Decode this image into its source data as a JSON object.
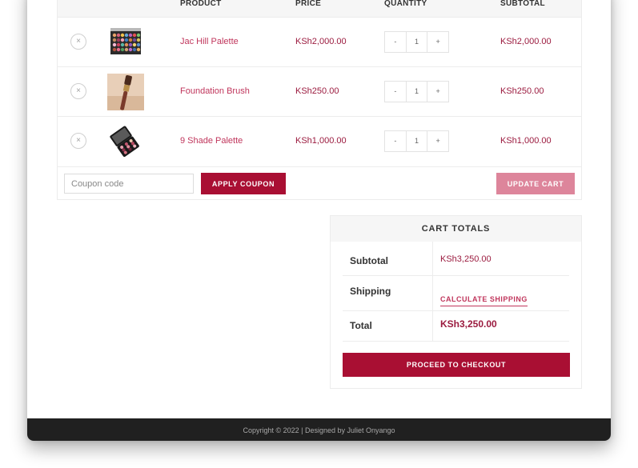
{
  "table": {
    "headers": {
      "product": "PRODUCT",
      "price": "PRICE",
      "quantity": "QUANTITY",
      "subtotal": "SUBTOTAL"
    },
    "rows": [
      {
        "remove": "×",
        "name": "Jac Hill Palette",
        "price": "KSh2,000.00",
        "qty_minus": "-",
        "qty": "1",
        "qty_plus": "+",
        "subtotal": "KSh2,000.00",
        "thumb": "eyeshadow-palette"
      },
      {
        "remove": "×",
        "name": "Foundation Brush",
        "price": "KSh250.00",
        "qty_minus": "-",
        "qty": "1",
        "qty_plus": "+",
        "subtotal": "KSh250.00",
        "thumb": "foundation-brush"
      },
      {
        "remove": "×",
        "name": "9 Shade Palette",
        "price": "KSh1,000.00",
        "qty_minus": "-",
        "qty": "1",
        "qty_plus": "+",
        "subtotal": "KSh1,000.00",
        "thumb": "compact-palette"
      }
    ]
  },
  "actions": {
    "coupon_placeholder": "Coupon code",
    "apply_label": "APPLY COUPON",
    "update_label": "UPDATE CART"
  },
  "totals": {
    "heading": "CART TOTALS",
    "subtotal_label": "Subtotal",
    "subtotal_value": "KSh3,250.00",
    "shipping_label": "Shipping",
    "shipping_link": "CALCULATE SHIPPING",
    "total_label": "Total",
    "total_value": "KSh3,250.00",
    "checkout_label": "PROCEED TO CHECKOUT"
  },
  "footer": {
    "text": "Copyright © 2022 | Designed by Juliet Onyango"
  },
  "colors": {
    "accent": "#a90f33",
    "accent_light": "#dd859b",
    "link": "#c0365c",
    "footer_bg": "#202020"
  }
}
